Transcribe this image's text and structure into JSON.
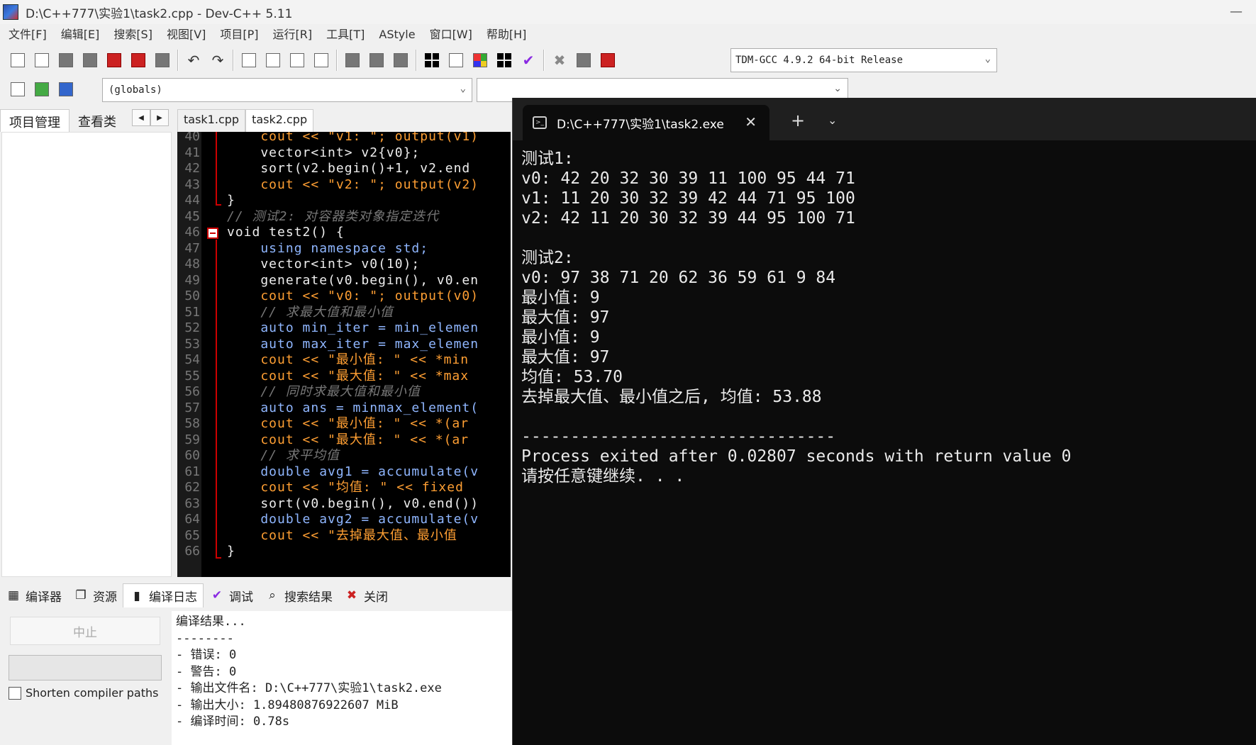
{
  "window": {
    "title": "D:\\C++777\\实验1\\task2.cpp - Dev-C++ 5.11",
    "minimize": "—"
  },
  "menu": [
    "文件[F]",
    "编辑[E]",
    "搜索[S]",
    "视图[V]",
    "项目[P]",
    "运行[R]",
    "工具[T]",
    "AStyle",
    "窗口[W]",
    "帮助[H]"
  ],
  "toolbar": {
    "compiler": "TDM-GCC 4.9.2 64-bit Release",
    "globals": "(globals)"
  },
  "left_tabs": [
    "项目管理",
    "查看类"
  ],
  "editor_tabs": [
    "task1.cpp",
    "task2.cpp"
  ],
  "code_lines": [
    {
      "n": "40",
      "t": "    cout << \"v1: \"; output(v1)",
      "k": "str"
    },
    {
      "n": "41",
      "t": "    vector<int> v2{v0};",
      "k": ""
    },
    {
      "n": "42",
      "t": "    sort(v2.begin()+1, v2.end",
      "k": ""
    },
    {
      "n": "43",
      "t": "    cout << \"v2: \"; output(v2)",
      "k": "str"
    },
    {
      "n": "44",
      "t": "}",
      "k": ""
    },
    {
      "n": "45",
      "t": "// 测试2: 对容器类对象指定迭代",
      "k": "cm"
    },
    {
      "n": "46",
      "t": "void test2() {",
      "k": ""
    },
    {
      "n": "47",
      "t": "    using namespace std;",
      "k": "kw"
    },
    {
      "n": "48",
      "t": "    vector<int> v0(10);",
      "k": ""
    },
    {
      "n": "49",
      "t": "    generate(v0.begin(), v0.en",
      "k": ""
    },
    {
      "n": "50",
      "t": "    cout << \"v0: \"; output(v0)",
      "k": "str"
    },
    {
      "n": "51",
      "t": "    // 求最大值和最小值",
      "k": "cm"
    },
    {
      "n": "52",
      "t": "    auto min_iter = min_elemen",
      "k": "kw"
    },
    {
      "n": "53",
      "t": "    auto max_iter = max_elemen",
      "k": "kw"
    },
    {
      "n": "54",
      "t": "    cout << \"最小值: \" << *min",
      "k": "str"
    },
    {
      "n": "55",
      "t": "    cout << \"最大值: \" << *max",
      "k": "str"
    },
    {
      "n": "56",
      "t": "    // 同时求最大值和最小值",
      "k": "cm"
    },
    {
      "n": "57",
      "t": "    auto ans = minmax_element(",
      "k": "kw"
    },
    {
      "n": "58",
      "t": "    cout << \"最小值: \" << *(ar",
      "k": "str"
    },
    {
      "n": "59",
      "t": "    cout << \"最大值: \" << *(ar",
      "k": "str"
    },
    {
      "n": "60",
      "t": "    // 求平均值",
      "k": "cm"
    },
    {
      "n": "61",
      "t": "    double avg1 = accumulate(v",
      "k": "kw"
    },
    {
      "n": "62",
      "t": "    cout << \"均值: \" << fixed",
      "k": "str"
    },
    {
      "n": "63",
      "t": "    sort(v0.begin(), v0.end())",
      "k": ""
    },
    {
      "n": "64",
      "t": "    double avg2 = accumulate(v",
      "k": "kw"
    },
    {
      "n": "65",
      "t": "    cout << \"去掉最大值、最小值",
      "k": "str"
    },
    {
      "n": "66",
      "t": "}",
      "k": ""
    }
  ],
  "bottom_tabs": [
    "编译器",
    "资源",
    "编译日志",
    "调试",
    "搜索结果",
    "关闭"
  ],
  "abort_label": "中止",
  "shorten_label": "Shorten compiler paths",
  "compile_log": [
    "编译结果...",
    "--------",
    "- 错误: 0",
    "- 警告: 0",
    "- 输出文件名: D:\\C++777\\实验1\\task2.exe",
    "- 输出大小: 1.89480876922607 MiB",
    "- 编译时间: 0.78s"
  ],
  "terminal": {
    "tab_title": "D:\\C++777\\实验1\\task2.exe",
    "new_tab": "+",
    "dropdown": "⌄",
    "close": "✕",
    "lines": [
      "测试1:",
      "v0: 42 20 32 30 39 11 100 95 44 71",
      "v1: 11 20 30 32 39 42 44 71 95 100",
      "v2: 42 11 20 30 32 39 44 95 100 71",
      "",
      "测试2:",
      "v0: 97 38 71 20 62 36 59 61 9 84",
      "最小值: 9",
      "最大值: 97",
      "最小值: 9",
      "最大值: 97",
      "均值: 53.70",
      "去掉最大值、最小值之后, 均值: 53.88",
      "",
      "--------------------------------",
      "Process exited after 0.02807 seconds with return value 0",
      "请按任意键继续. . ."
    ]
  }
}
